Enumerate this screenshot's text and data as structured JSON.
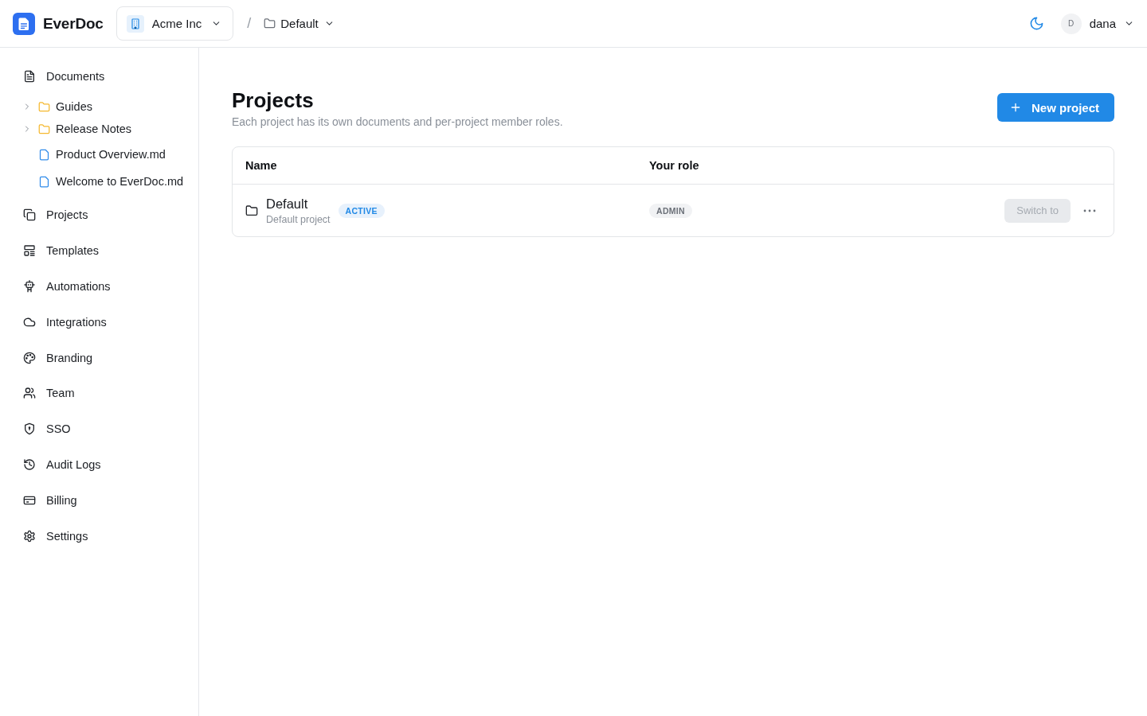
{
  "header": {
    "app_name": "EverDoc",
    "org_switcher": {
      "label": "Acme Inc"
    },
    "separator": "/",
    "project_switcher": {
      "label": "Default"
    },
    "user": {
      "avatar_initial": "D",
      "name": "dana"
    }
  },
  "sidebar": {
    "items": [
      {
        "label": "Documents",
        "children": [
          {
            "kind": "folder",
            "label": "Guides",
            "expanded": false
          },
          {
            "kind": "folder",
            "label": "Release Notes",
            "expanded": false
          },
          {
            "kind": "file",
            "label": "Product Overview.md"
          },
          {
            "kind": "file",
            "label": "Welcome to EverDoc.md"
          }
        ]
      },
      {
        "label": "Projects"
      },
      {
        "label": "Templates"
      },
      {
        "label": "Automations"
      },
      {
        "label": "Integrations"
      },
      {
        "label": "Branding"
      },
      {
        "label": "Team"
      },
      {
        "label": "SSO"
      },
      {
        "label": "Audit Logs"
      },
      {
        "label": "Billing"
      },
      {
        "label": "Settings"
      }
    ]
  },
  "page": {
    "title": "Projects",
    "subtitle": "Each project has its own documents and per-project member roles.",
    "new_button": {
      "label": "New project"
    }
  },
  "table": {
    "columns": [
      "Name",
      "Your role"
    ],
    "rows": [
      {
        "name": "Default",
        "description": "Default project",
        "badge": "ACTIVE",
        "role": "ADMIN",
        "switch_button": {
          "label": "Switch to",
          "disabled": true
        }
      }
    ]
  }
}
